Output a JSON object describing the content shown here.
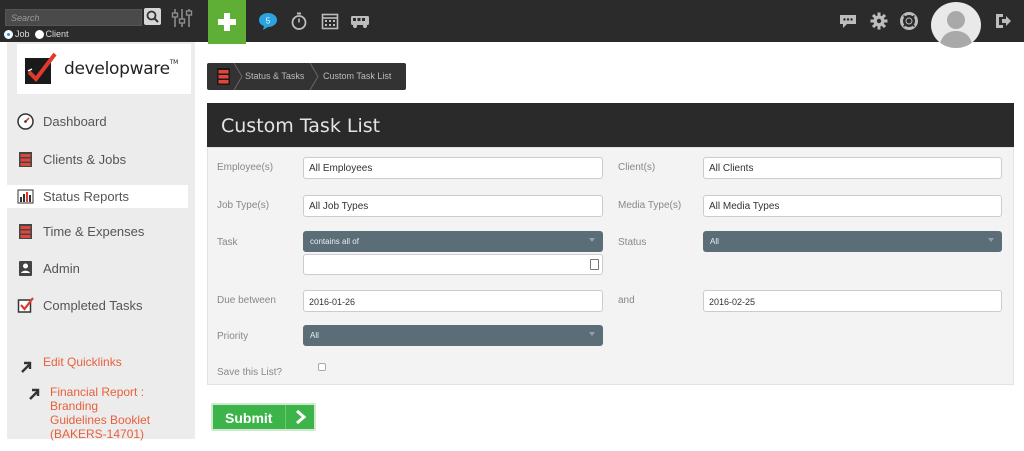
{
  "topbar": {
    "search_placeholder": "Search",
    "radio_job": "Job",
    "radio_client": "Client",
    "badge_count": "5"
  },
  "sidebar": {
    "logo_text": "developware",
    "logo_tm": "TM",
    "items": [
      {
        "label": "Dashboard",
        "icon": "dashboard-icon"
      },
      {
        "label": "Clients & Jobs",
        "icon": "cabinet-icon"
      },
      {
        "label": "Status Reports",
        "icon": "bar-chart-icon"
      },
      {
        "label": "Time & Expenses",
        "icon": "cabinet-icon"
      },
      {
        "label": "Admin",
        "icon": "badge-icon"
      },
      {
        "label": "Completed Tasks",
        "icon": "checkbox-icon"
      }
    ],
    "quicklinks": [
      {
        "label": "Edit Quicklinks"
      },
      {
        "line1": "Financial Report : Branding",
        "line2": "Guidelines Booklet",
        "line3": "(BAKERS-14701)"
      }
    ]
  },
  "breadcrumb": {
    "items": [
      "Status & Tasks",
      "Custom Task List"
    ]
  },
  "panel": {
    "title": "Custom Task List",
    "labels": {
      "employees": "Employee(s)",
      "clients": "Client(s)",
      "job_types": "Job Type(s)",
      "media_types": "Media Type(s)",
      "task": "Task",
      "status": "Status",
      "due_between": "Due between",
      "and": "and",
      "priority": "Priority",
      "save": "Save this List?"
    },
    "values": {
      "employees": "All Employees",
      "clients": "All Clients",
      "job_types": "All Job Types",
      "media_types": "All Media Types",
      "task_select": "contains all of",
      "status_select": "All",
      "due_from": "2016-01-26",
      "due_to": "2016-02-25",
      "priority_select": "All"
    },
    "submit_label": "Submit"
  },
  "colors": {
    "topbar": "#2b2b2b",
    "accent_green": "#5fae36",
    "link_orange": "#e8603c",
    "select_slate": "#5b6e78",
    "submit_green": "#3db44a"
  }
}
